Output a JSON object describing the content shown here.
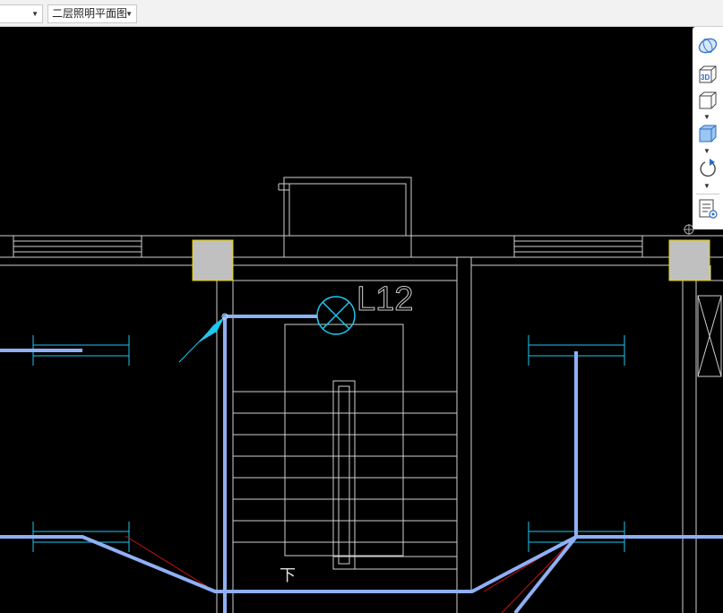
{
  "toolbar": {
    "view_selector": {
      "value": ""
    },
    "drawing_selector": {
      "value": "二层照明平面图"
    }
  },
  "drawing": {
    "lamp_label": "L12",
    "stair_direction_label": "下"
  },
  "view_tools": [
    {
      "icon": "orbit-icon"
    },
    {
      "icon": "3d-view-icon"
    },
    {
      "icon": "view-cube-icon",
      "has_dropdown": true
    },
    {
      "icon": "shaded-cube-icon",
      "has_dropdown": true
    },
    {
      "icon": "rotate-icon",
      "has_dropdown": true
    },
    {
      "icon": "properties-list-icon"
    }
  ],
  "colors": {
    "background": "#000000",
    "wall_lines": "#cfcfcf",
    "cable": "#8fb0f5",
    "fixture": "#1ec8f0",
    "column_fill": "#c0c0c0",
    "column_border": "#e6d400",
    "red_lines": "#d01010"
  }
}
